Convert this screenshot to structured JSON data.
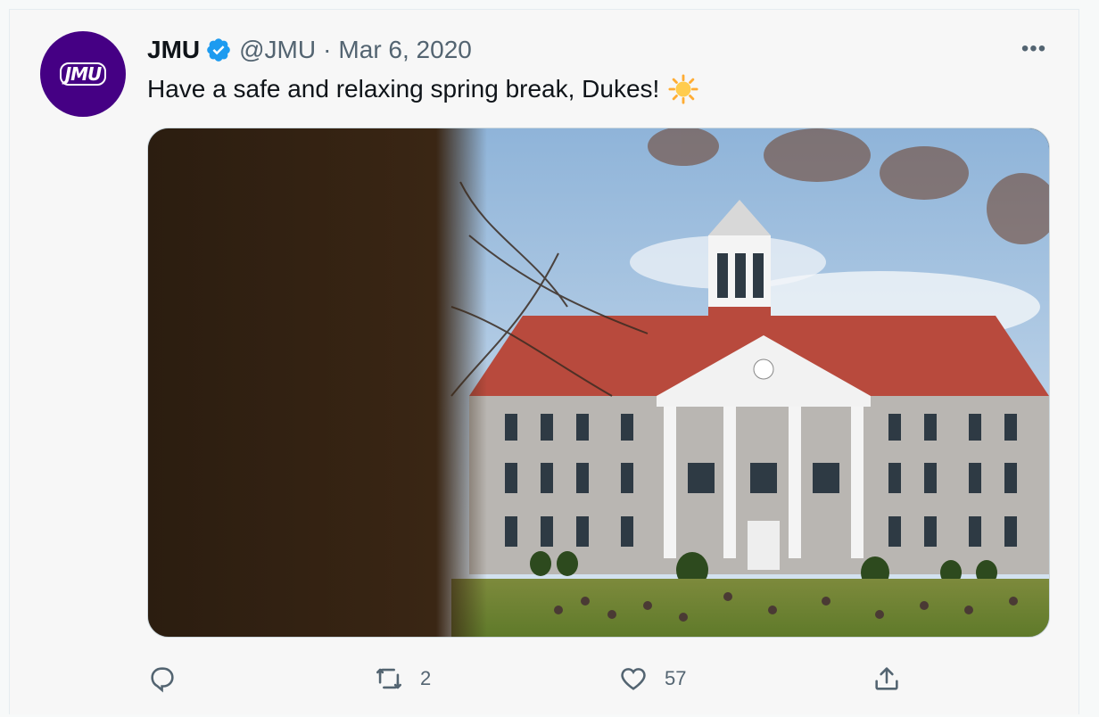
{
  "tweet": {
    "author_name": "JMU",
    "avatar_text": "JMU",
    "handle": "@JMU",
    "separator": "·",
    "date": "Mar 6, 2020",
    "text": "Have a safe and relaxing spring break, Dukes!",
    "emoji": "sun-emoji",
    "more_label": "•••"
  },
  "actions": {
    "reply_count": "",
    "retweet_count": "2",
    "like_count": "57"
  },
  "colors": {
    "brand_purple": "#450084",
    "verified_blue": "#1d9bf0",
    "muted_text": "#536471"
  }
}
